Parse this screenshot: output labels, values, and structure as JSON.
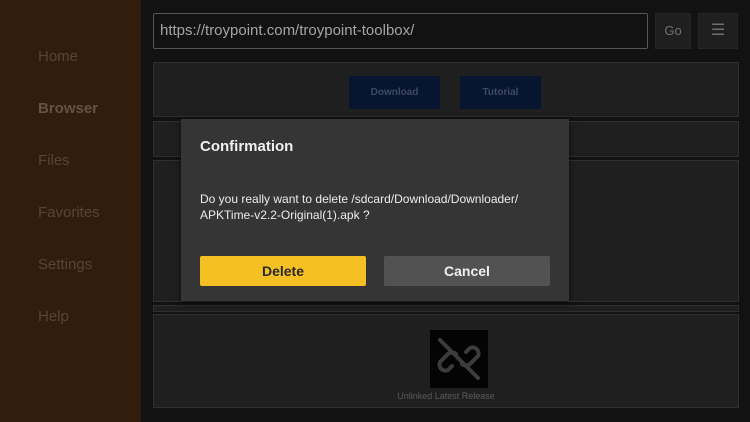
{
  "sidebar": {
    "items": [
      {
        "label": "Home"
      },
      {
        "label": "Browser"
      },
      {
        "label": "Files"
      },
      {
        "label": "Favorites"
      },
      {
        "label": "Settings"
      },
      {
        "label": "Help"
      }
    ],
    "active_index": 1
  },
  "toolbar": {
    "url": "https://troypoint.com/troypoint-toolbox/",
    "go_label": "Go",
    "menu_label": "☰"
  },
  "page": {
    "download_label": "Download",
    "tutorial_label": "Tutorial",
    "unlinked_label": "Unlinked Latest Release"
  },
  "dialog": {
    "title": "Confirmation",
    "message_line1": "Do you really want to delete /sdcard/Download/Downloader/",
    "message_line2": "APKTime-v2.2-Original(1).apk ?",
    "delete_label": "Delete",
    "cancel_label": "Cancel"
  },
  "colors": {
    "sidebar_bg": "#3d2411",
    "accent": "#f4c023",
    "dialog_bg": "#353535"
  }
}
